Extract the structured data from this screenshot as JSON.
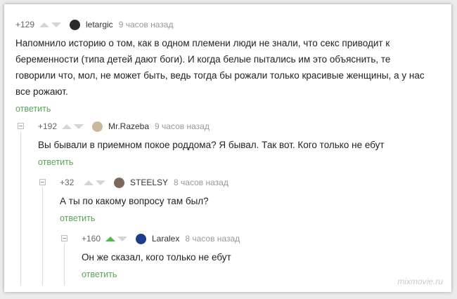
{
  "comments": [
    {
      "rating": "+129",
      "username": "letargic",
      "time": "9 часов назад",
      "text_lines": [
        "Напомнило историю о том, как в одном племени люди не знали, что секс приводит к",
        "беременности (типа детей дают боги). И когда белые пытались им это объяснить, те",
        "говорили что, мол, не может быть, ведь тогда бы рожали только красивые женщины, а у нас",
        "все рожают."
      ],
      "reply": "ответить",
      "avatar_color": "#2b2b2b"
    },
    {
      "rating": "+192",
      "username": "Mr.Razeba",
      "time": "9 часов назад",
      "text": "Вы бывали в приемном покое роддома? Я бывал. Так вот. Кого только не ебут",
      "reply": "ответить",
      "avatar_color": "#c9b89a"
    },
    {
      "rating": "+32",
      "username": "STEELSY",
      "time": "8 часов назад",
      "text": "А ты по какому вопросу там был?",
      "reply": "ответить",
      "avatar_color": "#7a6a5a"
    },
    {
      "rating": "+160",
      "username": "Laralex",
      "time": "8 часов назад",
      "text": "Он же сказал, кого только не ебут",
      "reply": "ответить",
      "avatar_color": "#1d3d8a"
    }
  ],
  "watermark": "mixmovie.ru",
  "colors": {
    "accent": "#5aa556",
    "upvote_active": "#53b84c"
  }
}
